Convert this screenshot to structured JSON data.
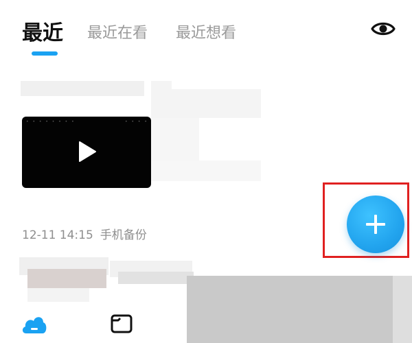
{
  "tabs": [
    {
      "label": "最近",
      "active": true
    },
    {
      "label": "最近在看",
      "active": false
    },
    {
      "label": "最近想看",
      "active": false
    }
  ],
  "header": {
    "eye_icon": "eye-icon"
  },
  "recent_item": {
    "timestamp": "12-11 14:15",
    "source": "手机备份"
  },
  "video": {
    "play_icon": "play-icon"
  },
  "fab": {
    "icon": "plus-icon",
    "color": "#22a4ee",
    "highlight_color": "#e02020"
  },
  "bottom_nav": [
    {
      "icon": "cloud-icon",
      "active": true,
      "color": "#1aa2f2"
    },
    {
      "icon": "folder-icon",
      "active": false
    }
  ]
}
